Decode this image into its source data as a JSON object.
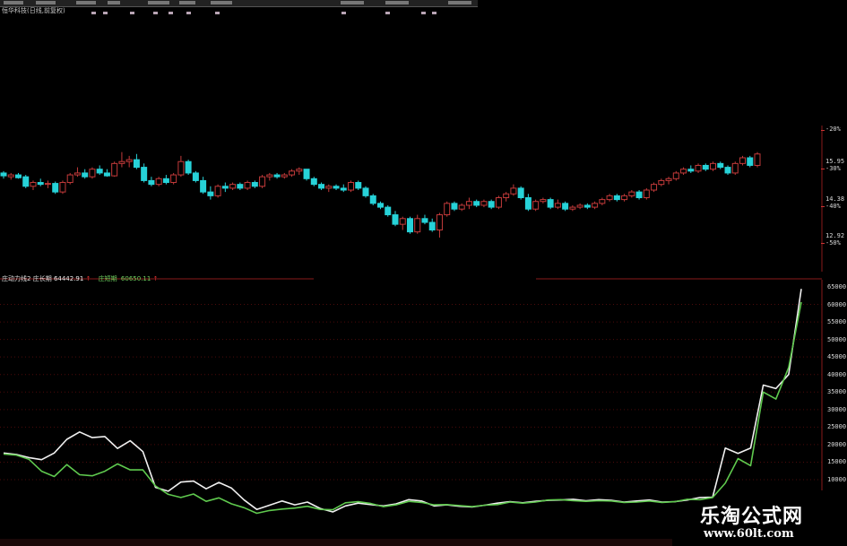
{
  "window": {
    "title": "恒华科技(日线,前复权)"
  },
  "price_panel": {
    "right_labels": [
      "15.95",
      "14.38",
      "12.92"
    ],
    "pct_labels": [
      "-20%",
      "-30%",
      "-40%",
      "-50%"
    ]
  },
  "indicator": {
    "name": "庄动力线2",
    "long_label": "庄长期",
    "long_value": "64442.91",
    "short_label": "庄短期",
    "short_value": "60650.11",
    "arrow": "↑"
  },
  "osc_labels": [
    "65000",
    "60000",
    "55000",
    "50000",
    "45000",
    "40000",
    "35000",
    "30000",
    "25000",
    "20000",
    "15000",
    "10000"
  ],
  "watermark": {
    "line1": "乐淘公式网",
    "line2": "www.60lt.com"
  },
  "colors": {
    "up": "#c23a3a",
    "down": "#27d2d8",
    "long_line": "#f0f0f0",
    "short_line": "#5fc94e",
    "grid": "#6e1111"
  },
  "chart_data": [
    {
      "type": "candlestick",
      "x_unit": "trading day",
      "y_ticks": [
        15.95,
        14.38,
        12.92
      ],
      "ohlc": [
        [
          16.0,
          16.1,
          15.7,
          15.85
        ],
        [
          15.8,
          16.0,
          15.65,
          15.9
        ],
        [
          15.9,
          16.0,
          15.7,
          15.75
        ],
        [
          15.8,
          15.9,
          15.2,
          15.3
        ],
        [
          15.3,
          15.6,
          15.1,
          15.5
        ],
        [
          15.5,
          15.7,
          15.3,
          15.4
        ],
        [
          15.4,
          15.6,
          15.2,
          15.45
        ],
        [
          15.45,
          15.55,
          14.9,
          15.0
        ],
        [
          15.0,
          15.6,
          14.9,
          15.5
        ],
        [
          15.5,
          16.0,
          15.4,
          15.9
        ],
        [
          15.9,
          16.3,
          15.8,
          16.0
        ],
        [
          16.0,
          16.2,
          15.7,
          15.8
        ],
        [
          15.8,
          16.3,
          15.7,
          16.2
        ],
        [
          16.2,
          16.4,
          15.9,
          16.0
        ],
        [
          16.0,
          16.2,
          15.8,
          15.85
        ],
        [
          15.85,
          16.6,
          15.8,
          16.5
        ],
        [
          16.5,
          17.1,
          16.3,
          16.6
        ],
        [
          16.6,
          16.9,
          16.3,
          16.7
        ],
        [
          16.7,
          17.0,
          16.2,
          16.3
        ],
        [
          16.3,
          16.5,
          15.5,
          15.6
        ],
        [
          15.6,
          15.8,
          15.3,
          15.4
        ],
        [
          15.4,
          15.8,
          15.3,
          15.7
        ],
        [
          15.7,
          15.9,
          15.4,
          15.5
        ],
        [
          15.5,
          16.0,
          15.4,
          15.9
        ],
        [
          15.9,
          16.9,
          15.8,
          16.6
        ],
        [
          16.6,
          16.7,
          15.9,
          16.0
        ],
        [
          16.0,
          16.1,
          15.5,
          15.6
        ],
        [
          15.6,
          15.8,
          14.9,
          15.0
        ],
        [
          15.0,
          15.3,
          14.6,
          14.8
        ],
        [
          14.8,
          15.4,
          14.7,
          15.3
        ],
        [
          15.3,
          15.5,
          15.0,
          15.2
        ],
        [
          15.2,
          15.5,
          15.1,
          15.4
        ],
        [
          15.4,
          15.5,
          15.1,
          15.2
        ],
        [
          15.2,
          15.6,
          15.1,
          15.5
        ],
        [
          15.5,
          15.6,
          15.2,
          15.3
        ],
        [
          15.3,
          15.9,
          15.2,
          15.8
        ],
        [
          15.8,
          16.0,
          15.6,
          15.9
        ],
        [
          15.9,
          16.0,
          15.7,
          15.8
        ],
        [
          15.8,
          16.0,
          15.7,
          15.9
        ],
        [
          15.9,
          16.2,
          15.8,
          16.1
        ],
        [
          16.1,
          16.3,
          15.9,
          16.2
        ],
        [
          16.2,
          16.2,
          15.6,
          15.7
        ],
        [
          15.7,
          15.8,
          15.3,
          15.4
        ],
        [
          15.4,
          15.5,
          15.1,
          15.2
        ],
        [
          15.2,
          15.4,
          15.0,
          15.3
        ],
        [
          15.3,
          15.4,
          15.1,
          15.2
        ],
        [
          15.2,
          15.4,
          15.0,
          15.1
        ],
        [
          15.1,
          15.6,
          15.0,
          15.5
        ],
        [
          15.5,
          15.6,
          15.1,
          15.2
        ],
        [
          15.2,
          15.3,
          14.7,
          14.8
        ],
        [
          14.8,
          14.9,
          14.3,
          14.4
        ],
        [
          14.4,
          14.5,
          14.1,
          14.2
        ],
        [
          14.2,
          14.3,
          13.7,
          13.8
        ],
        [
          13.8,
          14.0,
          13.2,
          13.3
        ],
        [
          13.3,
          13.7,
          13.0,
          13.6
        ],
        [
          13.6,
          13.7,
          12.8,
          12.9
        ],
        [
          12.9,
          13.8,
          12.8,
          13.6
        ],
        [
          13.6,
          13.8,
          13.3,
          13.4
        ],
        [
          13.4,
          13.6,
          12.9,
          13.0
        ],
        [
          13.0,
          13.9,
          12.6,
          13.8
        ],
        [
          13.8,
          14.5,
          13.7,
          14.4
        ],
        [
          14.4,
          14.5,
          14.0,
          14.1
        ],
        [
          14.1,
          14.4,
          14.0,
          14.3
        ],
        [
          14.3,
          14.7,
          14.1,
          14.5
        ],
        [
          14.5,
          14.6,
          14.2,
          14.3
        ],
        [
          14.3,
          14.6,
          14.2,
          14.5
        ],
        [
          14.5,
          14.6,
          14.1,
          14.2
        ],
        [
          14.2,
          14.8,
          14.1,
          14.7
        ],
        [
          14.7,
          15.0,
          14.5,
          14.9
        ],
        [
          14.9,
          15.4,
          14.8,
          15.2
        ],
        [
          15.2,
          15.3,
          14.6,
          14.7
        ],
        [
          14.7,
          14.9,
          14.0,
          14.1
        ],
        [
          14.1,
          14.6,
          14.0,
          14.5
        ],
        [
          14.5,
          14.7,
          14.4,
          14.6
        ],
        [
          14.6,
          14.7,
          14.1,
          14.2
        ],
        [
          14.2,
          14.6,
          14.1,
          14.4
        ],
        [
          14.4,
          14.5,
          14.0,
          14.1
        ],
        [
          14.1,
          14.3,
          14.0,
          14.2
        ],
        [
          14.2,
          14.4,
          14.1,
          14.3
        ],
        [
          14.3,
          14.4,
          14.1,
          14.2
        ],
        [
          14.2,
          14.5,
          14.1,
          14.4
        ],
        [
          14.4,
          14.7,
          14.3,
          14.6
        ],
        [
          14.6,
          14.9,
          14.5,
          14.8
        ],
        [
          14.8,
          14.9,
          14.5,
          14.6
        ],
        [
          14.6,
          14.9,
          14.5,
          14.8
        ],
        [
          14.8,
          15.1,
          14.7,
          15.0
        ],
        [
          15.0,
          15.1,
          14.6,
          14.7
        ],
        [
          14.7,
          15.2,
          14.6,
          15.1
        ],
        [
          15.1,
          15.5,
          15.0,
          15.4
        ],
        [
          15.4,
          15.7,
          15.3,
          15.6
        ],
        [
          15.6,
          15.8,
          15.4,
          15.7
        ],
        [
          15.7,
          16.1,
          15.6,
          16.0
        ],
        [
          16.0,
          16.3,
          15.9,
          16.2
        ],
        [
          16.2,
          16.4,
          16.0,
          16.1
        ],
        [
          16.1,
          16.5,
          16.0,
          16.4
        ],
        [
          16.4,
          16.5,
          16.1,
          16.2
        ],
        [
          16.2,
          16.6,
          16.1,
          16.5
        ],
        [
          16.5,
          16.6,
          16.2,
          16.3
        ],
        [
          16.3,
          16.4,
          15.9,
          16.0
        ],
        [
          16.0,
          16.6,
          15.9,
          16.5
        ],
        [
          16.5,
          16.9,
          16.4,
          16.8
        ],
        [
          16.8,
          16.9,
          16.3,
          16.4
        ],
        [
          16.4,
          17.1,
          16.3,
          17.0
        ]
      ]
    },
    {
      "type": "line",
      "y_ticks": [
        65000,
        60000,
        55000,
        50000,
        45000,
        40000,
        35000,
        30000,
        25000,
        20000,
        15000,
        10000
      ],
      "series": [
        {
          "name": "庄长期",
          "values": [
            17600,
            17200,
            16300,
            15700,
            17600,
            21500,
            23600,
            22000,
            22300,
            18900,
            21100,
            18000,
            7800,
            6700,
            9300,
            9600,
            7400,
            9200,
            7600,
            4200,
            1500,
            2700,
            3900,
            2800,
            3600,
            1800,
            800,
            2500,
            3300,
            2900,
            2500,
            3100,
            4300,
            3900,
            2500,
            2800,
            2400,
            2200,
            2700,
            3300,
            3700,
            3400,
            3800,
            4100,
            4200,
            4400,
            4000,
            4300,
            4100,
            3600,
            3900,
            4200,
            3600,
            3700,
            4200,
            4900,
            5000,
            19000,
            17500,
            19000,
            37000,
            36000,
            40000,
            64442
          ]
        },
        {
          "name": "庄短期",
          "values": [
            17300,
            17000,
            15800,
            12400,
            10900,
            14300,
            11400,
            11100,
            12400,
            14500,
            12800,
            12800,
            8200,
            5800,
            4900,
            5900,
            3800,
            4800,
            3100,
            2000,
            400,
            1200,
            1600,
            1900,
            2400,
            1500,
            1400,
            3400,
            3700,
            3200,
            2300,
            2800,
            3800,
            3500,
            2800,
            2900,
            2600,
            2300,
            2700,
            2900,
            3600,
            3300,
            3600,
            4200,
            4300,
            4000,
            3800,
            4000,
            3900,
            3500,
            3600,
            3900,
            3500,
            3700,
            4400,
            4300,
            4900,
            9000,
            16000,
            14000,
            35000,
            33000,
            42000,
            60650
          ]
        }
      ]
    }
  ]
}
